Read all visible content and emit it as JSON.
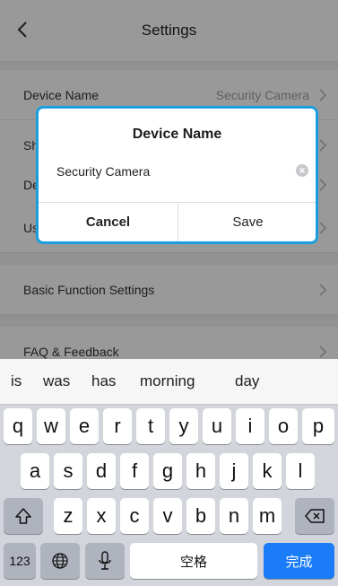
{
  "nav": {
    "title": "Settings",
    "back_icon": "chevron-left-icon"
  },
  "rows": [
    {
      "label": "Device Name",
      "value": "Security Camera"
    },
    {
      "label": "Sh",
      "value": ""
    },
    {
      "label": "De",
      "value": ""
    },
    {
      "label": "Us",
      "value": ""
    },
    {
      "label": "Basic Function Settings",
      "value": ""
    },
    {
      "label": "FAQ & Feedback",
      "value": ""
    }
  ],
  "dialog": {
    "title": "Device Name",
    "input_value": "Security Camera",
    "cancel_label": "Cancel",
    "save_label": "Save",
    "border_color": "#1a9ee0"
  },
  "keyboard": {
    "suggestions": [
      "is",
      "was",
      "has",
      "morning",
      "day"
    ],
    "row1": [
      "q",
      "w",
      "e",
      "r",
      "t",
      "y",
      "u",
      "i",
      "o",
      "p"
    ],
    "row2": [
      "a",
      "s",
      "d",
      "f",
      "g",
      "h",
      "j",
      "k",
      "l"
    ],
    "row3": [
      "z",
      "x",
      "c",
      "v",
      "b",
      "n",
      "m"
    ],
    "numbers_label": "123",
    "space_label": "空格",
    "done_label": "完成",
    "done_color": "#1a7cf6"
  }
}
